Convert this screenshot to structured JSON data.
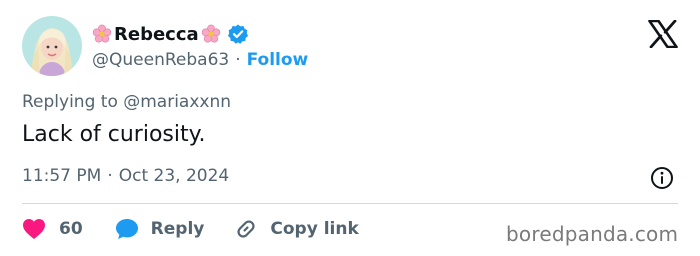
{
  "author": {
    "display_name": "Rebecca",
    "handle": "@QueenReba63",
    "follow_label": "Follow",
    "separator": "·",
    "verified_color": "#1d9bf0",
    "name_decoration_icon": "cherry-blossom-icon"
  },
  "tweet": {
    "replying_to": "Replying to @mariaxxnn",
    "text": "Lack of curiosity.",
    "time": "11:57 PM",
    "time_separator": "·",
    "date": "Oct 23, 2024"
  },
  "actions": {
    "like_count": "60",
    "reply_label": "Reply",
    "copy_link_label": "Copy link"
  },
  "watermark": "boredpanda.com",
  "colors": {
    "accent": "#1d9bf0",
    "like": "#f91880",
    "muted": "#536471",
    "text": "#0f1419"
  }
}
